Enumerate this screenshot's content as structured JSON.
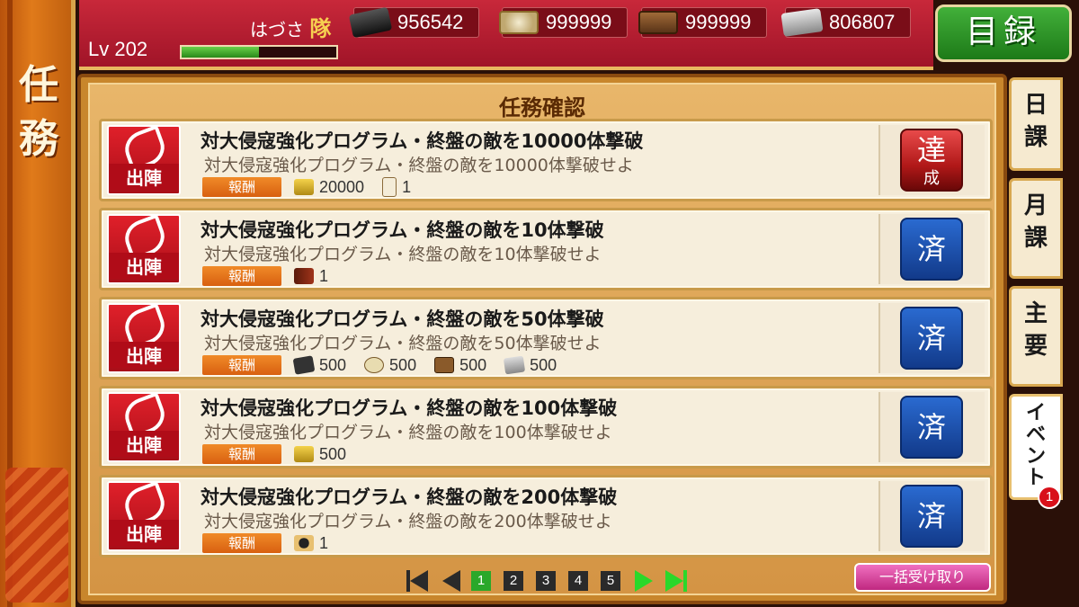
{
  "side_banner": {
    "title_line1": "任",
    "title_line2": "務"
  },
  "header": {
    "team_name": "はづさ",
    "team_mark": "隊",
    "level_label": "Lv 202",
    "level_progress": 0.5,
    "resources": [
      {
        "icon": "wood-icon",
        "value": "956542"
      },
      {
        "icon": "rice-icon",
        "value": "999999"
      },
      {
        "icon": "box-icon",
        "value": "999999"
      },
      {
        "icon": "steel-icon",
        "value": "806807"
      }
    ],
    "catalog_label": "目録"
  },
  "panel": {
    "title": "任務確認",
    "missions": [
      {
        "type_label": "出陣",
        "title": "対大侵寇強化プログラム・終盤の敵を10000体撃破",
        "desc": "対大侵寇強化プログラム・終盤の敵を10000体撃破せよ",
        "reward_label": "報酬",
        "rewards": [
          {
            "icon": "gold-icon",
            "qty": "20000"
          },
          {
            "icon": "scroll-icon",
            "qty": "1"
          }
        ],
        "status": "achieved",
        "status_text": "達",
        "status_sub": "成"
      },
      {
        "type_label": "出陣",
        "title": "対大侵寇強化プログラム・終盤の敵を10体撃破",
        "desc": "対大侵寇強化プログラム・終盤の敵を10体撃破せよ",
        "reward_label": "報酬",
        "rewards": [
          {
            "icon": "book-icon",
            "qty": "1"
          }
        ],
        "status": "done",
        "status_text": "済"
      },
      {
        "type_label": "出陣",
        "title": "対大侵寇強化プログラム・終盤の敵を50体撃破",
        "desc": "対大侵寇強化プログラム・終盤の敵を50体撃破せよ",
        "reward_label": "報酬",
        "rewards": [
          {
            "icon": "wood-icon",
            "qty": "500"
          },
          {
            "icon": "rice-icon",
            "qty": "500"
          },
          {
            "icon": "box-icon",
            "qty": "500"
          },
          {
            "icon": "steel-icon",
            "qty": "500"
          }
        ],
        "status": "done",
        "status_text": "済"
      },
      {
        "type_label": "出陣",
        "title": "対大侵寇強化プログラム・終盤の敵を100体撃破",
        "desc": "対大侵寇強化プログラム・終盤の敵を100体撃破せよ",
        "reward_label": "報酬",
        "rewards": [
          {
            "icon": "gold-icon",
            "qty": "500"
          }
        ],
        "status": "done",
        "status_text": "済"
      },
      {
        "type_label": "出陣",
        "title": "対大侵寇強化プログラム・終盤の敵を200体撃破",
        "desc": "対大侵寇強化プログラム・終盤の敵を200体撃破せよ",
        "reward_label": "報酬",
        "rewards": [
          {
            "icon": "character-icon",
            "qty": "1"
          }
        ],
        "status": "done",
        "status_text": "済"
      }
    ]
  },
  "tabs": [
    {
      "label_1": "日",
      "label_2": "課"
    },
    {
      "label_1": "月",
      "label_2": "課"
    },
    {
      "label_1": "主",
      "label_2": "要"
    },
    {
      "label_1": "イ",
      "label_2": "ベ",
      "label_3": "ン",
      "label_4": "ト",
      "badge": "1"
    }
  ],
  "pager": {
    "pages": [
      "1",
      "2",
      "3",
      "4",
      "5"
    ],
    "current": "1"
  },
  "bulk_receive_label": "一括受け取り"
}
